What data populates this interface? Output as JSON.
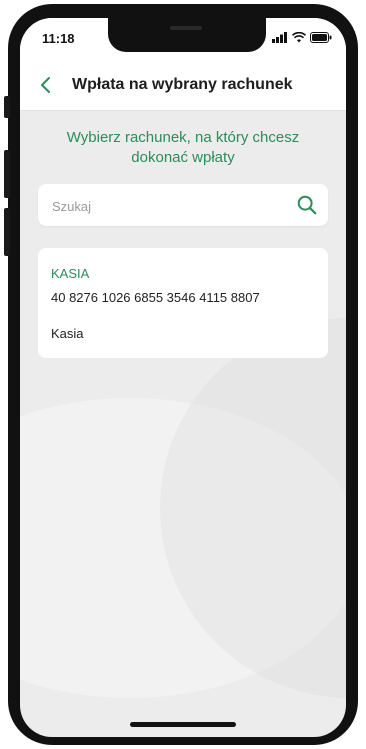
{
  "status_bar": {
    "time": "11:18",
    "icons": [
      "signal-icon",
      "wifi-icon",
      "battery-icon"
    ]
  },
  "header": {
    "back_icon": "chevron-left-icon",
    "title": "Wpłata na wybrany rachunek"
  },
  "instruction": "Wybierz rachunek, na który chcesz dokonać wpłaty",
  "search": {
    "placeholder": "Szukaj",
    "value": "",
    "icon": "search-icon"
  },
  "accounts": [
    {
      "name": "KASIA",
      "number": "40 8276 1026 6855 3546 4115 8807",
      "owner": "Kasia"
    }
  ],
  "colors": {
    "accent": "#2c8c5a",
    "background": "#ececec",
    "card": "#ffffff",
    "text": "#222222"
  }
}
